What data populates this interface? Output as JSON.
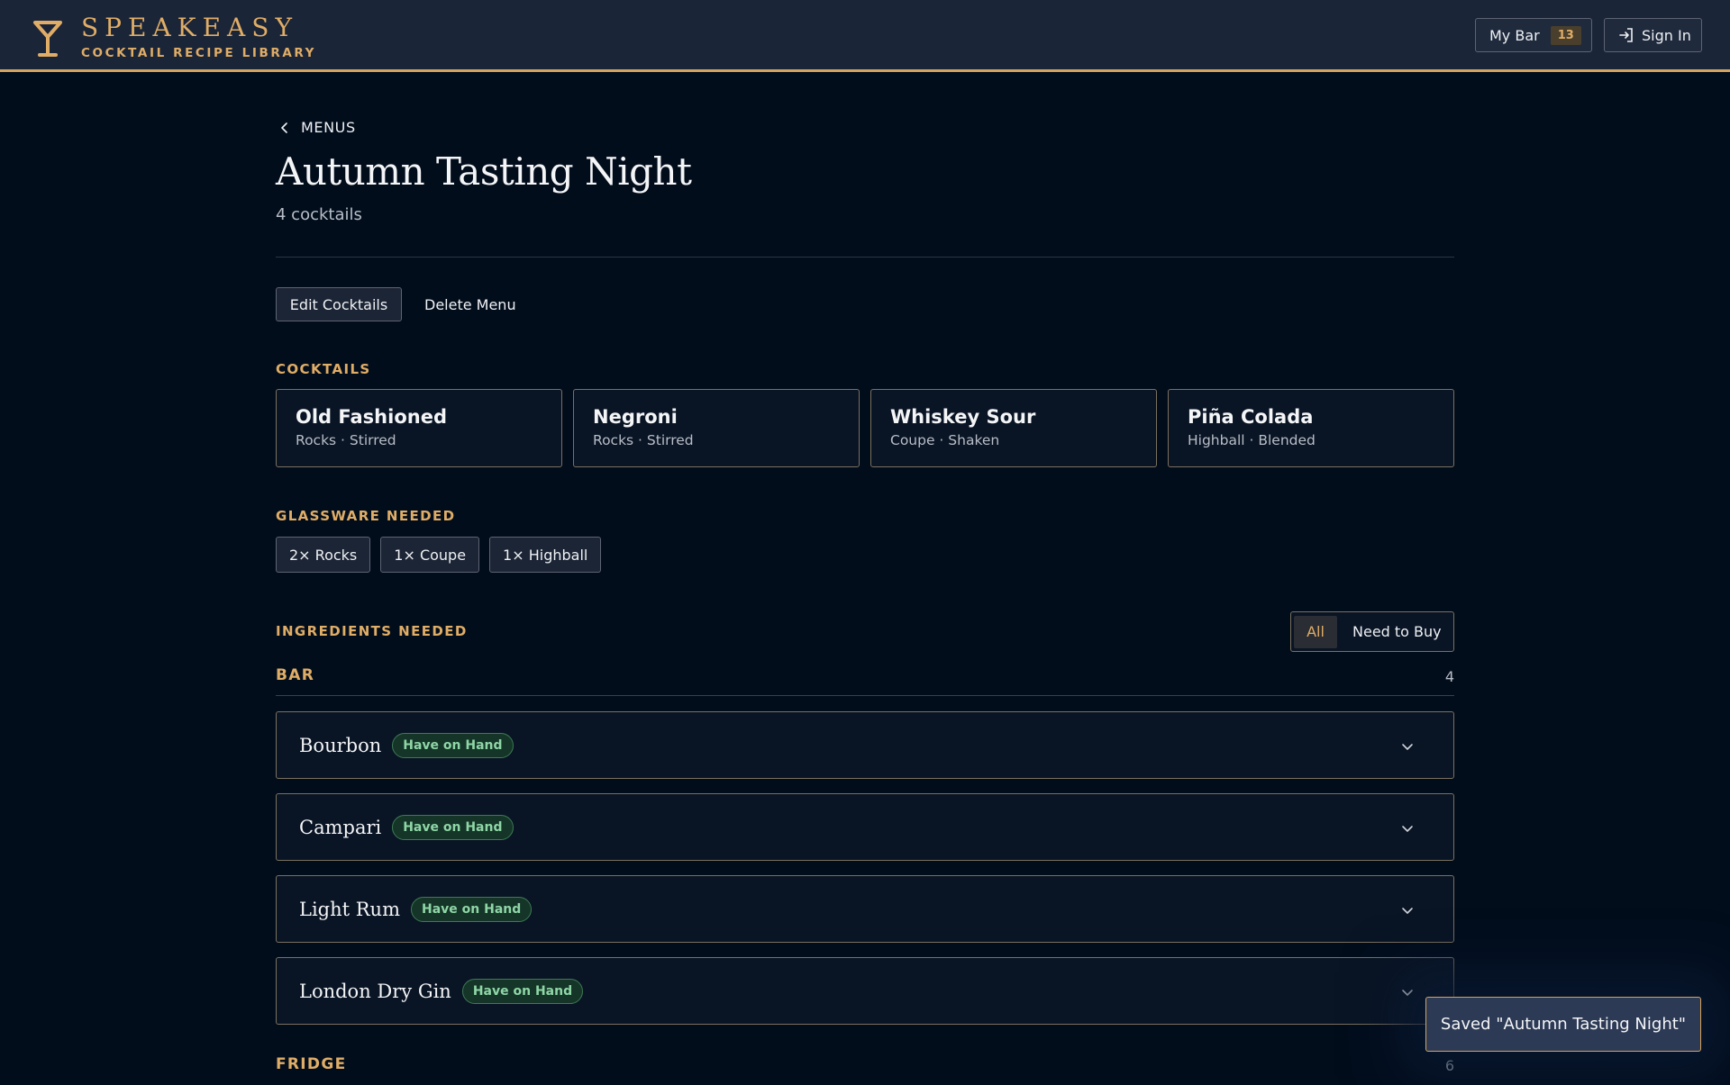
{
  "header": {
    "brand_name": "SPEAKEASY",
    "brand_subtitle": "COCKTAIL RECIPE LIBRARY",
    "brand_icon": "martini-glass-icon",
    "my_bar_label": "My Bar",
    "my_bar_count": "13",
    "sign_in_label": "Sign In",
    "accent_color": "#e0ad66"
  },
  "page": {
    "back_label": "MENUS",
    "title": "Autumn Tasting Night",
    "count_text": "4 cocktails",
    "edit_label": "Edit Cocktails",
    "delete_label": "Delete Menu"
  },
  "cocktails": {
    "label": "COCKTAILS",
    "items": [
      {
        "name": "Old Fashioned",
        "meta": "Rocks · Stirred"
      },
      {
        "name": "Negroni",
        "meta": "Rocks · Stirred"
      },
      {
        "name": "Whiskey Sour",
        "meta": "Coupe · Shaken"
      },
      {
        "name": "Piña Colada",
        "meta": "Highball · Blended"
      }
    ]
  },
  "glassware": {
    "label": "GLASSWARE NEEDED",
    "items": [
      "2× Rocks",
      "1× Coupe",
      "1× Highball"
    ]
  },
  "ingredients": {
    "label": "INGREDIENTS NEEDED",
    "filter_all": "All",
    "filter_buy": "Need to Buy",
    "filter_selected": "All",
    "groups": [
      {
        "title": "BAR",
        "count": "4",
        "items": [
          {
            "name": "Bourbon",
            "badge": "Have on Hand"
          },
          {
            "name": "Campari",
            "badge": "Have on Hand"
          },
          {
            "name": "Light Rum",
            "badge": "Have on Hand"
          },
          {
            "name": "London Dry Gin",
            "badge": "Have on Hand"
          }
        ]
      },
      {
        "title": "FRIDGE",
        "count": "6",
        "items": []
      }
    ]
  },
  "toast": {
    "message": "Saved \"Autumn Tasting Night\""
  }
}
